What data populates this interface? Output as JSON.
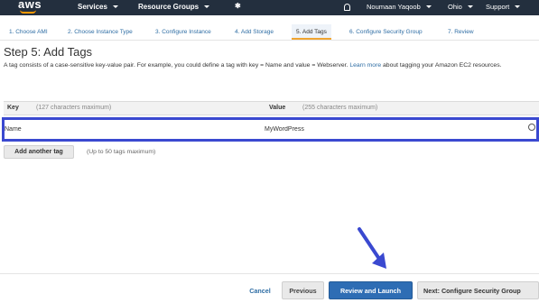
{
  "topbar": {
    "logo": "aws",
    "services": "Services",
    "resource_groups": "Resource Groups",
    "user": "Noumaan Yaqoob",
    "region": "Ohio",
    "support": "Support"
  },
  "steps": [
    {
      "label": "1. Choose AMI",
      "active": false
    },
    {
      "label": "2. Choose Instance Type",
      "active": false
    },
    {
      "label": "3. Configure Instance",
      "active": false
    },
    {
      "label": "4. Add Storage",
      "active": false
    },
    {
      "label": "5. Add Tags",
      "active": true
    },
    {
      "label": "6. Configure Security Group",
      "active": false
    },
    {
      "label": "7. Review",
      "active": false
    }
  ],
  "page": {
    "title": "Step 5: Add Tags",
    "desc_before_link": "A tag consists of a case-sensitive key-value pair. For example, you could define a tag with key = Name and value = Webserver.",
    "learn_more": "Learn more",
    "desc_after_link": "about tagging your Amazon EC2 resources."
  },
  "table": {
    "key_header": "Key",
    "key_hint": "(127 characters maximum)",
    "value_header": "Value",
    "value_hint": "(255 characters maximum)",
    "row": {
      "key": "Name",
      "value": "MyWordPress"
    }
  },
  "add_tag": {
    "button": "Add another tag",
    "hint": "(Up to 50 tags maximum)"
  },
  "footer": {
    "cancel": "Cancel",
    "previous": "Previous",
    "review_launch": "Review and Launch",
    "next": "Next: Configure Security Group"
  },
  "colors": {
    "topbar": "#232f3e",
    "accent_orange": "#ff9900",
    "highlight_border": "#3a49d0",
    "primary_button": "#2e6db4",
    "link": "#2e6da4"
  }
}
